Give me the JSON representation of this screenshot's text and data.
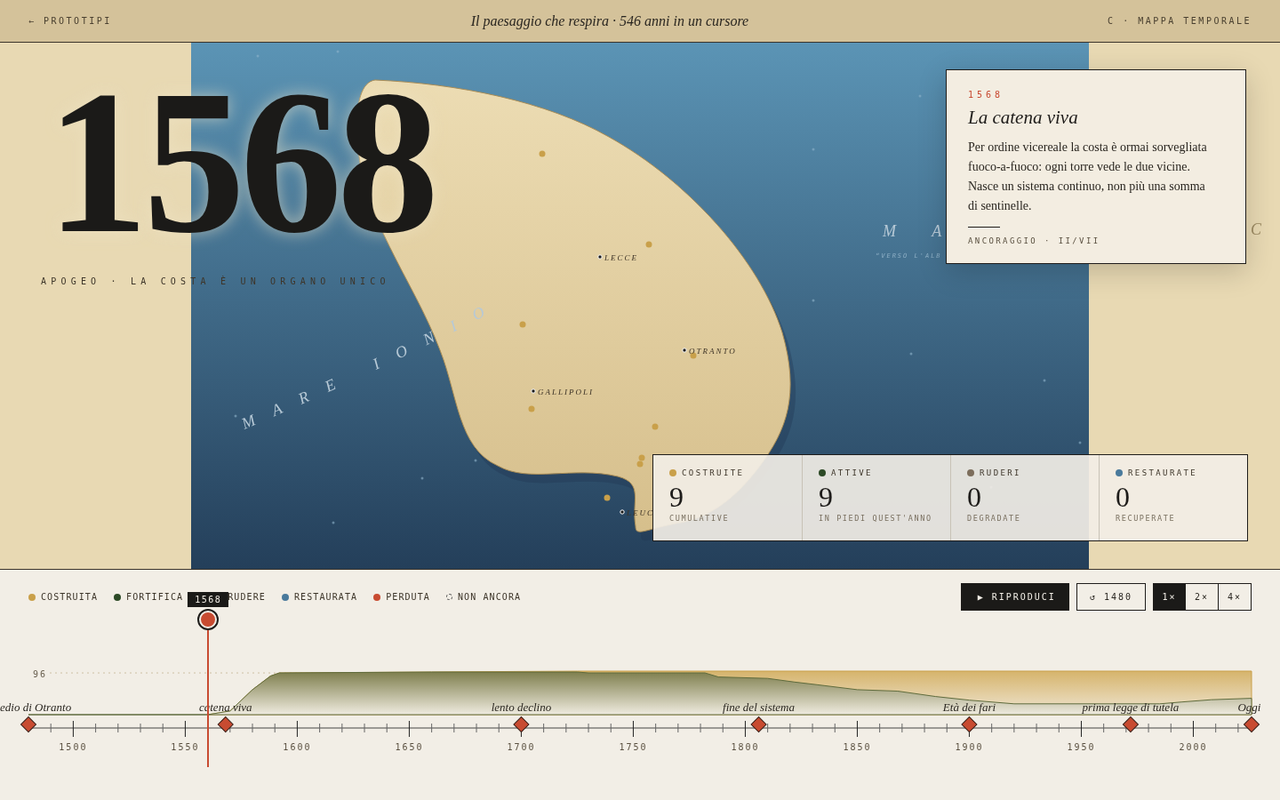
{
  "header": {
    "back_link": "← PROTOTIPI",
    "title": "Il paesaggio che respira · 546 anni in un cursore",
    "section": "C · MAPPA TEMPORALE"
  },
  "hero": {
    "year": "1568",
    "subtitle": "APOGEO · LA COSTA È UN ORGANO UNICO"
  },
  "map": {
    "sea_labels": [
      "MARE IONIO",
      "M A",
      "“VERSO L'ALB",
      "C"
    ],
    "cities": [
      {
        "name": "LECCE"
      },
      {
        "name": "OTRANTO"
      },
      {
        "name": "GALLIPOLI"
      },
      {
        "name": "LEUC"
      }
    ]
  },
  "event_card": {
    "year": "1568",
    "title": "La catena viva",
    "body": "Per ordine vicereale la costa è ormai sorvegliata fuoco-a-fuoco: ogni torre vede le due vicine. Nasce un sistema continuo, non più una somma di sentinelle.",
    "footer": "ANCORAGGIO · II/VII"
  },
  "stats": [
    {
      "label": "COSTRUITE",
      "color": "#c9a04a",
      "value": "9",
      "note": "CUMULATIVE"
    },
    {
      "label": "ATTIVE",
      "color": "#2c4a26",
      "value": "9",
      "note": "IN PIEDI QUEST'ANNO"
    },
    {
      "label": "RUDERI",
      "color": "#7d6e5c",
      "value": "0",
      "note": "DEGRADATE"
    },
    {
      "label": "RESTAURATE",
      "color": "#4a7a9c",
      "value": "0",
      "note": "RECUPERATE"
    }
  ],
  "legend": [
    {
      "label": "COSTRUITA",
      "kind": "dot",
      "color": "#c9a04a"
    },
    {
      "label": "FORTIFICA",
      "kind": "dot",
      "color": "#2c4a26"
    },
    {
      "label": "RUDERE",
      "kind": "text"
    },
    {
      "label": "RESTAURATA",
      "kind": "dot",
      "color": "#4a7a9c"
    },
    {
      "label": "PERDUTA",
      "kind": "dot",
      "color": "#c84b31"
    },
    {
      "label": "NON ANCORA",
      "kind": "dashed"
    }
  ],
  "controls": {
    "play": "▶ RIPRODUCI",
    "reset": "↺ 1480",
    "speeds": [
      {
        "label": "1×",
        "selected": true
      },
      {
        "label": "2×",
        "selected": false
      },
      {
        "label": "4×",
        "selected": false
      }
    ]
  },
  "timeline": {
    "max_label": "96",
    "scrubber": {
      "label": "1568",
      "level": 0.147
    },
    "milestones": [
      "edio di Otranto",
      "catena viva",
      "lento declino",
      "fine del sistema",
      "Età dei fari",
      "prima legge di tutela",
      "Oggi"
    ],
    "ticks": [
      "1500",
      "1550",
      "1600",
      "1650",
      "1700",
      "1750",
      "1800",
      "1850",
      "1900",
      "1950",
      "2000"
    ]
  }
}
